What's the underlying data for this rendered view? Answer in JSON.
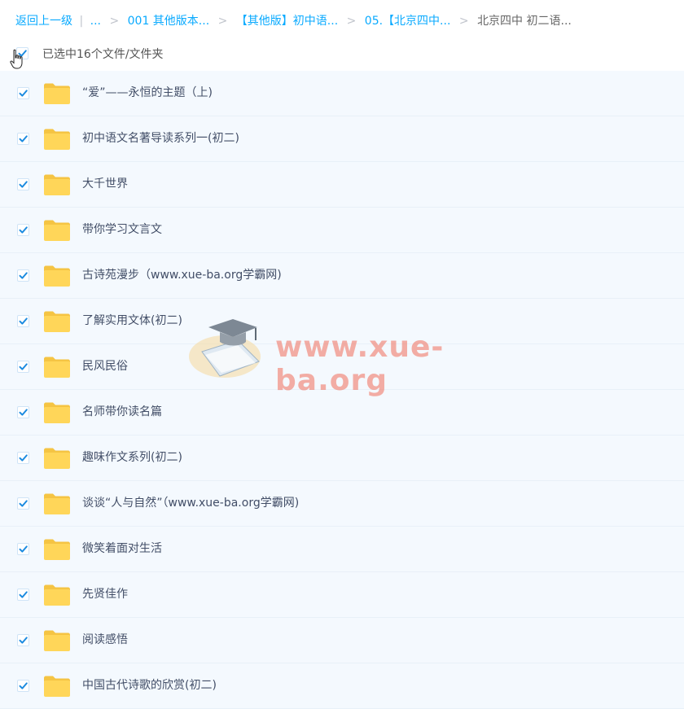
{
  "breadcrumb": {
    "back": "返回上一级",
    "ellipsis": "...",
    "crumbs": [
      "001 其他版本...",
      "【其他版】初中语...",
      "05.【北京四中..."
    ],
    "current": "北京四中 初二语..."
  },
  "selection": {
    "label": "已选中16个文件/文件夹",
    "checked": true
  },
  "files": [
    {
      "name": "“爱”——永恒的主题（上)",
      "type": "folder",
      "checked": true
    },
    {
      "name": "初中语文名著导读系列一(初二)",
      "type": "folder",
      "checked": true
    },
    {
      "name": "大千世界",
      "type": "folder",
      "checked": true
    },
    {
      "name": "带你学习文言文",
      "type": "folder",
      "checked": true
    },
    {
      "name": "古诗苑漫步（www.xue-ba.org学霸网)",
      "type": "folder",
      "checked": true
    },
    {
      "name": "了解实用文体(初二)",
      "type": "folder",
      "checked": true
    },
    {
      "name": "民风民俗",
      "type": "folder",
      "checked": true
    },
    {
      "name": "名师带你读名篇",
      "type": "folder",
      "checked": true
    },
    {
      "name": "趣味作文系列(初二)",
      "type": "folder",
      "checked": true
    },
    {
      "name": "谈谈“人与自然”（www.xue-ba.org学霸网)",
      "type": "folder",
      "checked": true
    },
    {
      "name": "微笑着面对生活",
      "type": "folder",
      "checked": true
    },
    {
      "name": "先贤佳作",
      "type": "folder",
      "checked": true
    },
    {
      "name": "阅读感悟",
      "type": "folder",
      "checked": true
    },
    {
      "name": "中国古代诗歌的欣赏(初二)",
      "type": "folder",
      "checked": true
    }
  ],
  "watermark": {
    "text": "www.xue-ba.org"
  },
  "colors": {
    "accent": "#09AAFF",
    "check": "#1C8BE0",
    "folder": "#FFD659",
    "folder_tab": "#F5C443",
    "row_bg": "#F4F9FE"
  },
  "icons": {
    "checkbox": "check-icon",
    "folder": "folder-icon",
    "cursor": "hand-cursor-icon",
    "watermark_logo": "graduation-cap-logo"
  }
}
